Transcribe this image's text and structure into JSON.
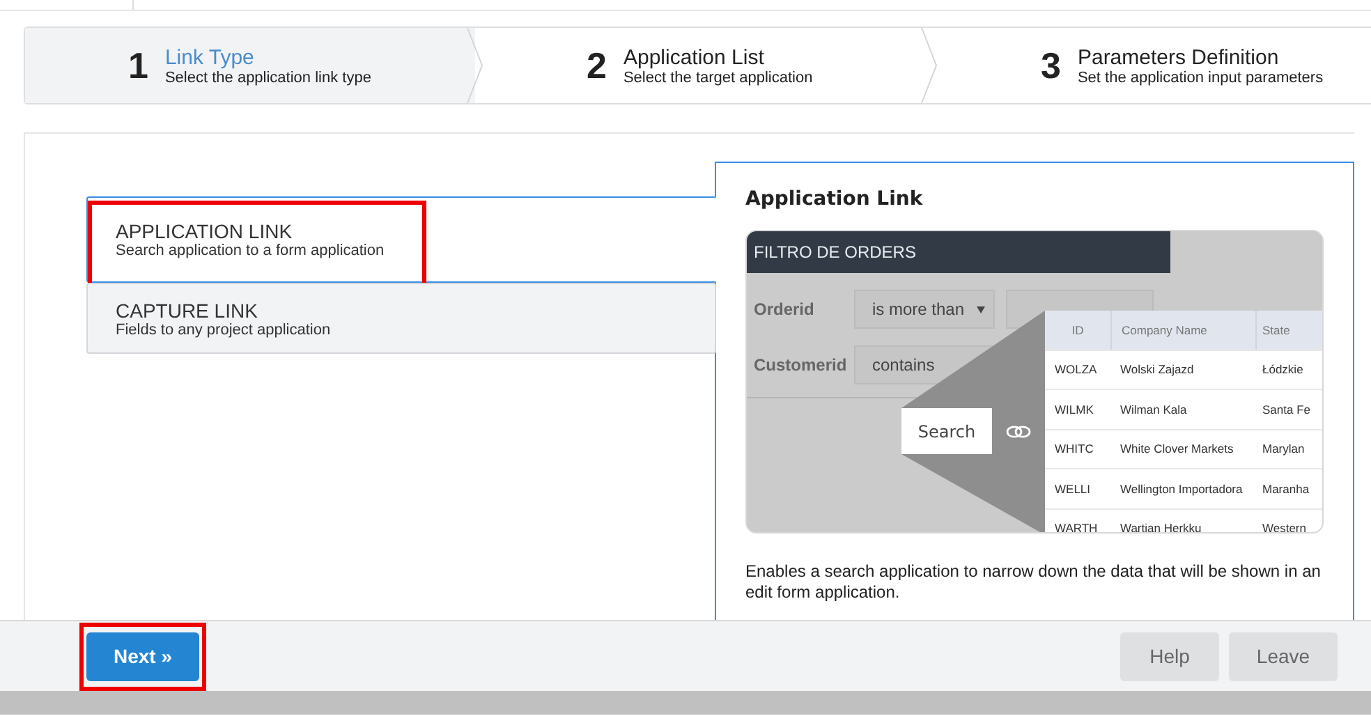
{
  "steps": [
    {
      "number": "1",
      "title": "Link Type",
      "subtitle": "Select the application link type",
      "selected": true
    },
    {
      "number": "2",
      "title": "Application List",
      "subtitle": "Select the target application",
      "selected": false
    },
    {
      "number": "3",
      "title": "Parameters Definition",
      "subtitle": "Set the application input parameters",
      "selected": false
    }
  ],
  "link_types": [
    {
      "title": "APPLICATION LINK",
      "subtitle": "Search application to a form application",
      "selected": true,
      "highlighted": true
    },
    {
      "title": "CAPTURE LINK",
      "subtitle": "Fields to any project application",
      "selected": false,
      "highlighted": false
    }
  ],
  "detail": {
    "title": "Application Link",
    "preview": {
      "header": "FILTRO DE ORDERS",
      "filters": [
        {
          "label": "Orderid",
          "operator": "is more than"
        },
        {
          "label": "Customerid",
          "operator": "contains"
        }
      ],
      "search_button": "Search",
      "table": {
        "columns": [
          "ID",
          "Company Name",
          "State"
        ],
        "rows": [
          [
            "WOLZA",
            "Wolski Zajazd",
            "Łódzkie"
          ],
          [
            "WILMK",
            "Wilman Kala",
            "Santa Fe"
          ],
          [
            "WHITC",
            "White Clover Markets",
            "Marylan"
          ],
          [
            "WELLI",
            "Wellington Importadora",
            "Maranha"
          ],
          [
            "WARTH",
            "Wartian Herkku",
            "Western"
          ]
        ]
      }
    },
    "description": "Enables a search application to narrow down the data that will be shown in an edit form application."
  },
  "footer": {
    "next_button": {
      "label": "Next »",
      "highlighted": true
    },
    "help_button": "Help",
    "leave_button": "Leave"
  }
}
